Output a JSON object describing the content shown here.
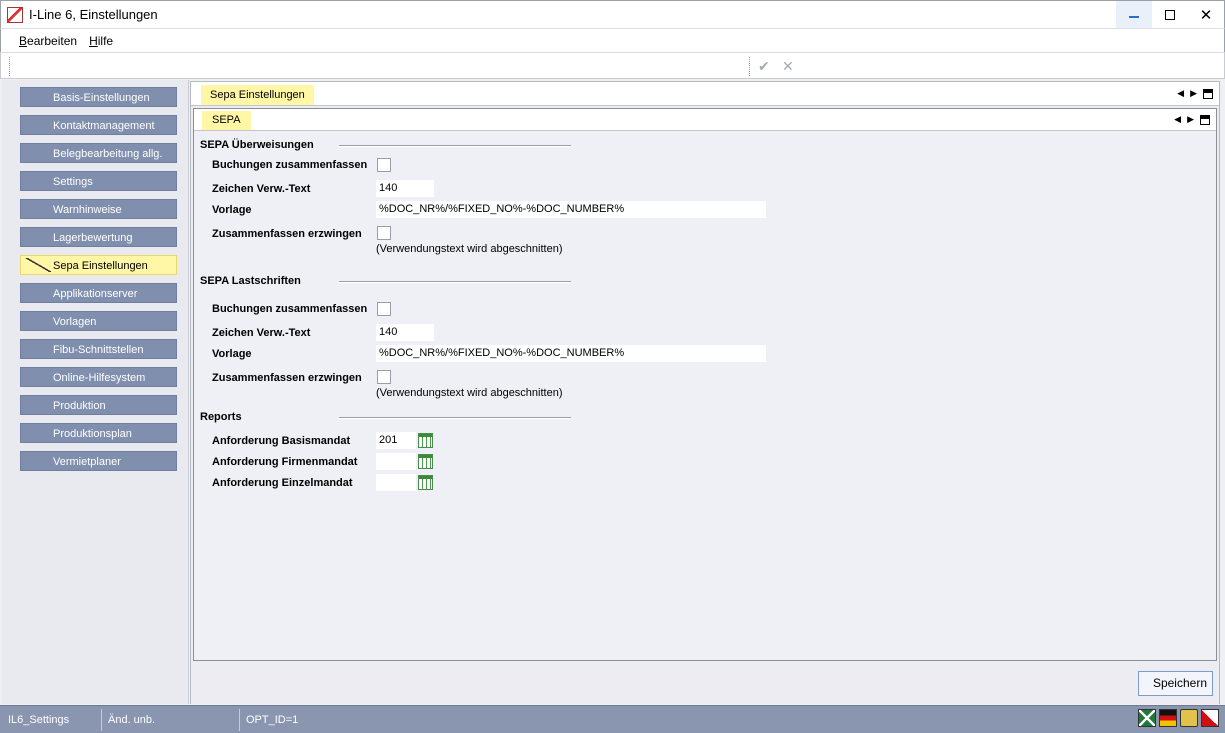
{
  "window": {
    "title": "I-Line 6, Einstellungen"
  },
  "menu": {
    "items": [
      {
        "accel": "B",
        "rest": "earbeiten"
      },
      {
        "accel": "H",
        "rest": "ilfe"
      }
    ]
  },
  "toolbar": {
    "confirm_icon": "checkmark-icon",
    "cancel_icon": "x-icon"
  },
  "nav": {
    "items": [
      "Basis-Einstellungen",
      "Kontaktmanagement",
      "Belegbearbeitung allg.",
      "Settings",
      "Warnhinweise",
      "Lagerbewertung",
      "Sepa Einstellungen",
      "Applikationserver",
      "Vorlagen",
      "Fibu-Schnittstellen",
      "Online-Hilfesystem",
      "Produktion",
      "Produktionsplan",
      "Vermietplaner"
    ],
    "active_index": 6
  },
  "main": {
    "tab": "Sepa Einstellungen",
    "subtab": "SEPA",
    "ueberweisungen": {
      "title": "SEPA Überweisungen",
      "buchungen_label": "Buchungen zusammenfassen",
      "zeichen_label": "Zeichen Verw.-Text",
      "zeichen_value": "140",
      "vorlage_label": "Vorlage",
      "vorlage_value": "%DOC_NR%/%FIXED_NO%-%DOC_NUMBER%",
      "erzwingen_label": "Zusammenfassen erzwingen",
      "hint": "(Verwendungstext wird abgeschnitten)"
    },
    "lastschriften": {
      "title": "SEPA Lastschriften",
      "buchungen_label": "Buchungen zusammenfassen",
      "zeichen_label": "Zeichen Verw.-Text",
      "zeichen_value": "140",
      "vorlage_label": "Vorlage",
      "vorlage_value": "%DOC_NR%/%FIXED_NO%-%DOC_NUMBER%",
      "erzwingen_label": "Zusammenfassen erzwingen",
      "hint": "(Verwendungstext wird abgeschnitten)"
    },
    "reports": {
      "title": "Reports",
      "basis_label": "Anforderung Basismandat",
      "basis_value": "201",
      "firmen_label": "Anforderung Firmenmandat",
      "firmen_value": "",
      "einzel_label": "Anforderung Einzelmandat",
      "einzel_value": ""
    }
  },
  "buttons": {
    "save": "Speichern"
  },
  "status": {
    "cell1": "IL6_Settings",
    "cell2": "Änd. unb.",
    "cell3": "OPT_ID=1",
    "icons": [
      "excel-icon",
      "german-flag-icon",
      "lock-icon",
      "alert-icon"
    ]
  }
}
